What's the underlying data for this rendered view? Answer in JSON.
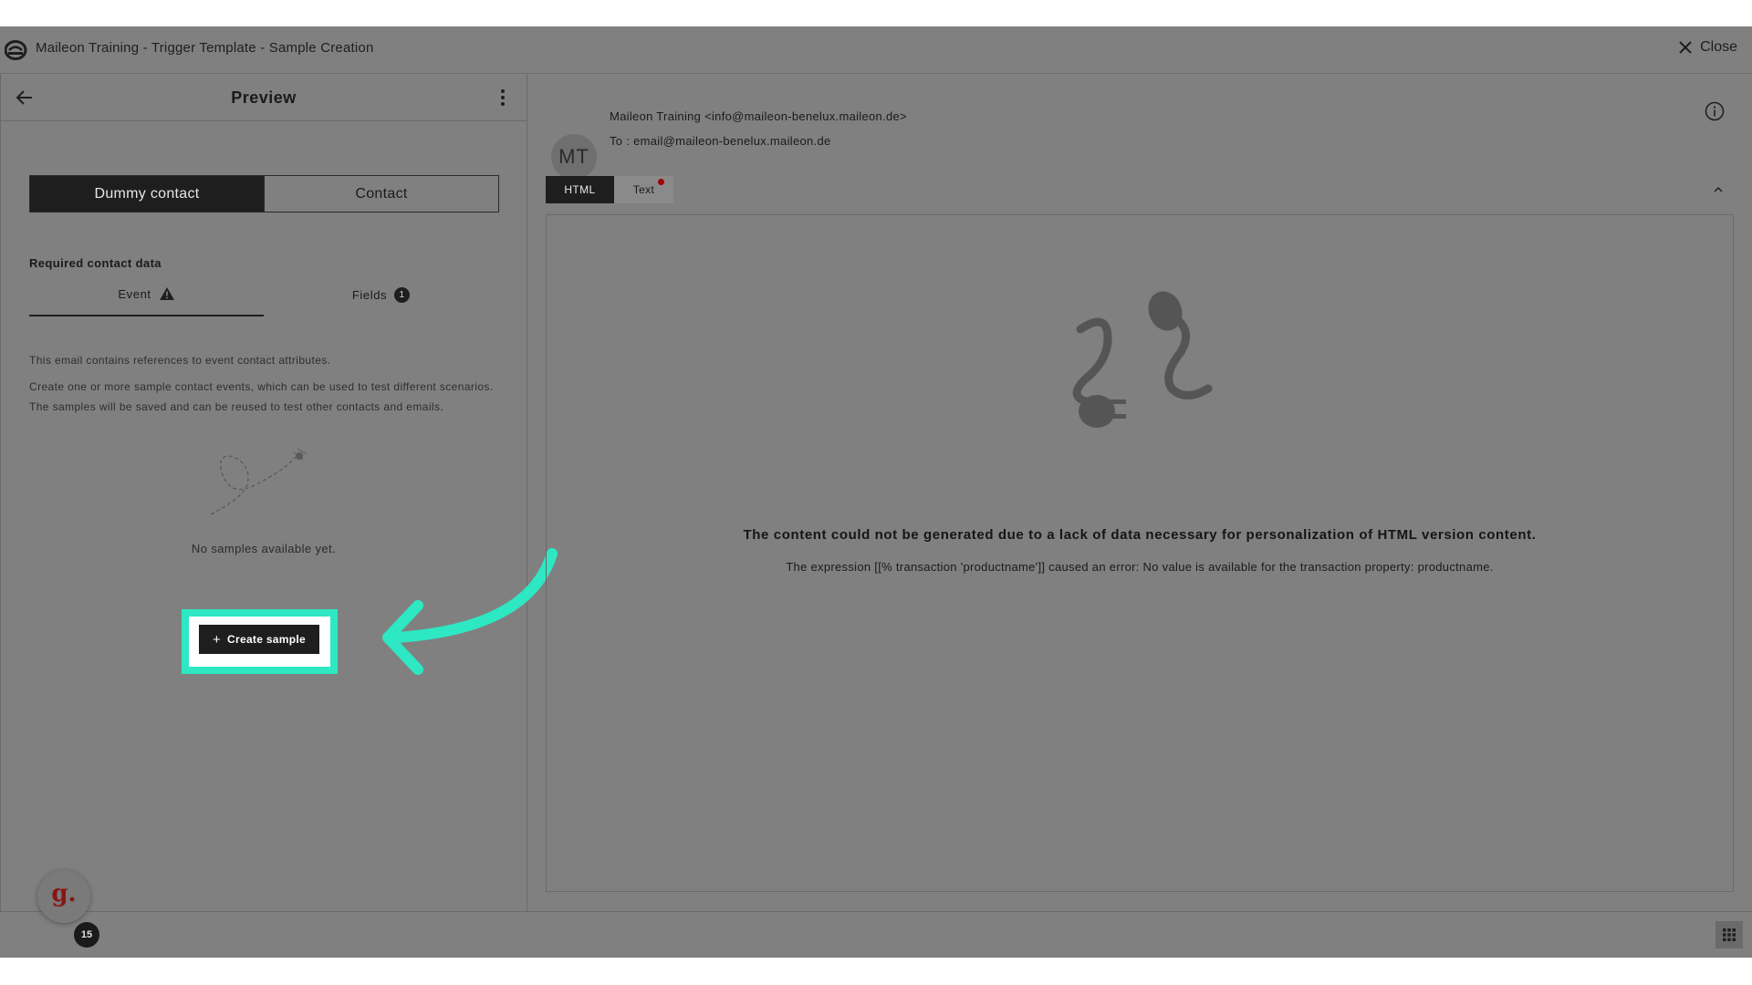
{
  "window": {
    "title": "Maileon Training - Trigger Template - Sample Creation",
    "close_label": "Close"
  },
  "left_panel": {
    "title": "Preview",
    "segments": [
      {
        "label": "Dummy contact",
        "active": true
      },
      {
        "label": "Contact",
        "active": false
      }
    ],
    "required_label": "Required contact data",
    "subtabs": {
      "event_label": "Event",
      "fields_label": "Fields",
      "fields_count": "1"
    },
    "description_line1": "This email contains references to event contact attributes.",
    "description_line2": "Create one or more sample contact events, which can be used to test different scenarios. The samples will be saved and can be reused to test other contacts and emails.",
    "empty_text": "No samples available yet.",
    "create_button_label": "Create sample"
  },
  "email_header": {
    "avatar_initials": "MT",
    "from": "Maileon Training <info@maileon-benelux.maileon.de>",
    "to": "To : email@maileon-benelux.maileon.de"
  },
  "format_tabs": [
    {
      "label": "HTML",
      "active": true
    },
    {
      "label": "Text",
      "active": false,
      "has_error_dot": true
    }
  ],
  "content": {
    "error_title": "The content could not be generated due to a lack of data necessary for personalization of HTML version content.",
    "error_detail": "The expression [[% transaction 'productname']] caused an error: No value is available for the transaction property: productname."
  },
  "widget": {
    "letter": "g.",
    "badge_count": "15"
  },
  "colors": {
    "overlay": "#808080",
    "highlight": "#2de8c3",
    "dark": "#1e1e1e",
    "error_dot": "#a00000"
  },
  "icons": [
    "maileon-logo-icon",
    "close-icon",
    "back-arrow-icon",
    "kebab-menu-icon",
    "warning-icon",
    "info-icon",
    "chevron-up-icon",
    "grid-icon",
    "plug-icon",
    "plus-icon"
  ]
}
